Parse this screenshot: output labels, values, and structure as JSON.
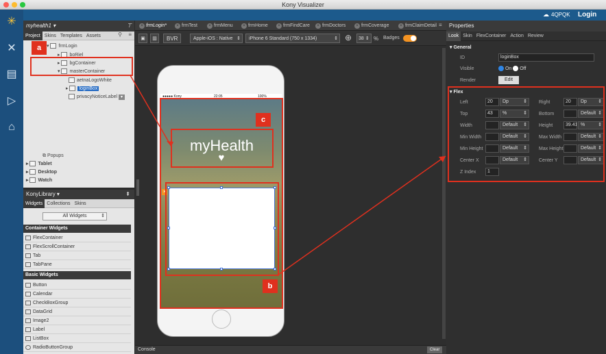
{
  "window": {
    "title": "Kony Visualizer"
  },
  "topbar": {
    "cloud_id": "4QPQK",
    "login_label": "Login"
  },
  "project_panel": {
    "project_name": "myhealth1",
    "tabs": [
      "Project",
      "Skins",
      "Templates",
      "Assets"
    ],
    "tree": [
      {
        "label": "frmLogin",
        "indent": 0
      },
      {
        "label": "boRiel",
        "indent": 1
      },
      {
        "label": "bgContainer",
        "indent": 1
      },
      {
        "label": "masterContainer",
        "indent": 1
      },
      {
        "label": "aetnaLogoWhite",
        "indent": 2
      },
      {
        "label": "loginBox",
        "indent": 2
      },
      {
        "label": "privacyNoticeLabel",
        "indent": 2
      }
    ],
    "popups_label": "Popups",
    "channels": [
      "Tablet",
      "Desktop",
      "Watch"
    ]
  },
  "library": {
    "title": "KonyLibrary",
    "tabs": [
      "Widgets",
      "Collections",
      "Skins"
    ],
    "filter": "All Widgets",
    "sections": [
      {
        "title": "Container Widgets",
        "items": [
          "FlexContainer",
          "FlexScrollContainer",
          "Tab",
          "TabPane"
        ]
      },
      {
        "title": "Basic Widgets",
        "items": [
          "Button",
          "Calendar",
          "CheckBoxGroup",
          "DataGrid",
          "Image2",
          "Label",
          "ListBox",
          "RadioButtonGroup"
        ]
      }
    ]
  },
  "editor": {
    "tabs": [
      "frmLogin*",
      "frmTest",
      "frmMenu",
      "frmHome",
      "frmFindCare",
      "frmDoctors",
      "frmCoverage",
      "frmClaimDetail"
    ],
    "bvr_label": "BVR",
    "platform": "Apple-iOS : Native",
    "device": "iPhone 6 Standard (750 x 1334)",
    "zoom": "38",
    "zoom_unit": "%",
    "badges_label": "Badges",
    "console_label": "Console",
    "clear_label": "Clear"
  },
  "phone": {
    "carrier": "●●●●● Kony",
    "time": "22:05",
    "battery": "100%",
    "app_title": "myHealth",
    "heart": "♥"
  },
  "properties": {
    "title": "Properties",
    "tabs": [
      "Look",
      "Skin",
      "FlexContainer",
      "Action",
      "Review"
    ],
    "general_title": "General",
    "id_label": "ID",
    "id_value": "loginBox",
    "visible_label": "Visible",
    "on_label": "On",
    "off_label": "Off",
    "render_label": "Render",
    "edit_label": "Edit",
    "flex_title": "Flex",
    "left_label": "Left",
    "left_value": "20",
    "left_unit": "Dp",
    "right_label": "Right",
    "right_value": "20",
    "right_unit": "Dp",
    "top_label": "Top",
    "top_value": "43",
    "top_unit": "%",
    "bottom_label": "Bottom",
    "bottom_unit": "Default",
    "width_label": "Width",
    "width_unit": "Default",
    "height_label": "Height",
    "height_value": "39.41",
    "height_unit": "%",
    "minwidth_label": "Min Width",
    "minwidth_unit": "Default",
    "maxwidth_label": "Max Width",
    "maxwidth_unit": "Default",
    "minheight_label": "Min Height",
    "minheight_unit": "Default",
    "maxheight_label": "Max Height",
    "maxheight_unit": "Default",
    "centerx_label": "Center X",
    "centerx_unit": "Default",
    "centery_label": "Center Y",
    "centery_unit": "Default",
    "zindex_label": "Z Index",
    "zindex_value": "1"
  },
  "annotations": {
    "a": "a",
    "b": "b",
    "c": "c"
  },
  "colors": {
    "annotation_red": "#e0301e",
    "brand_blue": "#1c5a8c",
    "selection_blue": "#1f67c2"
  }
}
